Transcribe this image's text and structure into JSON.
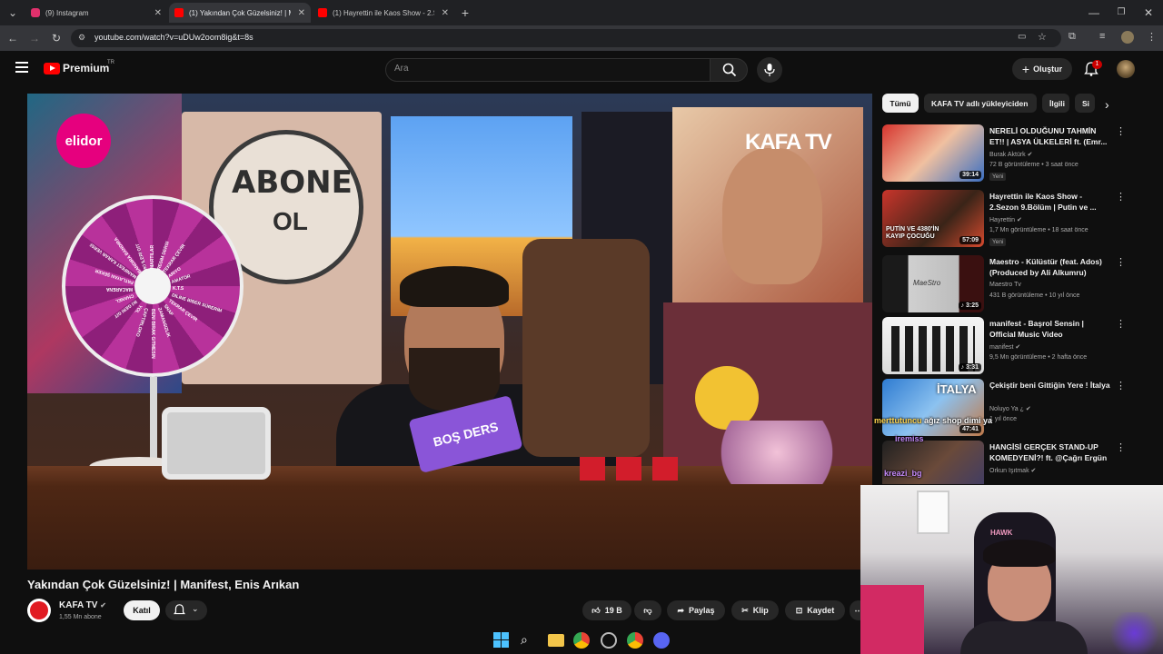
{
  "browser": {
    "tabs": [
      {
        "title": "(9) Instagram",
        "color": "#e1306c"
      },
      {
        "title": "(1) Yakından Çok Güzelsiniz! | Ma",
        "color": "#ff0000"
      },
      {
        "title": "(1) Hayrettin ile Kaos Show - 2.S",
        "color": "#ff0000"
      }
    ],
    "url": "youtube.com/watch?v=uDUw2oom8ig&t=8s"
  },
  "header": {
    "logo": "Premium",
    "region": "TR",
    "search_placeholder": "Ara",
    "create_label": "Oluştur",
    "notifications": "1"
  },
  "video_overlay": {
    "elidor": "elidor",
    "kafatv": "KAFA TV",
    "abone": "ABONE",
    "ol": "OL",
    "bosders": "BOŞ DERS",
    "wheel_labels": [
      "MARTILAR",
      "RESİM DERSİ",
      "TEKRAR ÇEVİR",
      "ARIYO",
      "AMATÖR",
      "K.T.S",
      "DİLİNE BİBER SÜRERİM",
      "TEKRAR ÇEVİR",
      "SNAP",
      "ZAMANSIZLIK",
      "BENİ BIRAK GİTMESİN",
      "ÇAPTIRLOKO",
      "YOL",
      "İKİ GERİ GİT",
      "CHANEL",
      "MACARENA",
      "PATLAYAN ŞEKER",
      "MANİFEST KARAR VERSİN",
      "BANDIRA BANDIRA",
      "İKİ İLERİ GİT"
    ]
  },
  "video": {
    "title": "Yakından Çok Güzelsiniz! | Manifest, Enis Arıkan",
    "channel": "KAFA TV",
    "subscribers": "1,55 Mn abone",
    "join_label": "Katıl",
    "likes": "19 B",
    "share_label": "Paylaş",
    "clip_label": "Klip",
    "save_label": "Kaydet"
  },
  "chips": [
    "Tümü",
    "KAFA TV adlı yükleyiciden",
    "İlgili",
    "Si"
  ],
  "recommendations": [
    {
      "title": "NERELİ OLDUĞUNU TAHMİN ET!! | ASYA ÜLKELERİ ft. (Emr...",
      "channel": "Burak Aktürk",
      "views": "72 B görüntüleme",
      "age": "3 saat önce",
      "badge": "Yeni",
      "duration": "39:14"
    },
    {
      "title": "Hayrettin ile Kaos Show - 2.Sezon 9.Bölüm | Putin ve ...",
      "channel": "Hayrettin",
      "views": "1,7 Mn görüntüleme",
      "age": "18 saat önce",
      "badge": "Yeni",
      "duration": "57:09"
    },
    {
      "title": "Maestro - Külüstür (feat. Ados) (Produced by Ali Alkumru)",
      "channel": "Maestro Tv",
      "views": "431 B görüntüleme",
      "age": "10 yıl önce",
      "badge": "",
      "duration": "3:25"
    },
    {
      "title": "manifest - Başrol Sensin | Official Music Video",
      "channel": "manifest",
      "views": "9,5 Mn görüntüleme",
      "age": "2 hafta önce",
      "badge": "",
      "duration": "3:31"
    },
    {
      "title": "Çekiştir beni Gittiğin Yere ! İtalya",
      "channel": "Noluyo Ya ¿",
      "views": "",
      "age": "1 yıl önce",
      "badge": "",
      "duration": "47:41"
    },
    {
      "title": "HANGİSİ GERÇEK STAND-UP KOMEDYENİ?! ft. @Çağrı Ergün",
      "channel": "Orkun Işıtmak",
      "views": "",
      "age": "",
      "badge": "",
      "duration": ""
    }
  ],
  "thumb_text": {
    "putin": "PUTİN VE 4380'İN KAYIP ÇOCUĞU",
    "italya": "İTALYA",
    "maestro": "MaeStro"
  },
  "chat": [
    {
      "user": "merttutuncu",
      "message": "ağız shop dimi ya",
      "color": "#ffd54f"
    },
    {
      "user": "iremiss",
      "message": "",
      "color": "#c58af9"
    },
    {
      "user": "kreazi_bg",
      "message": "",
      "color": "#c58af9"
    }
  ],
  "webcam": {
    "chair_brand": "HAWK"
  },
  "colors": {
    "accent": "#ff0000",
    "bg": "#0f0f0f"
  }
}
